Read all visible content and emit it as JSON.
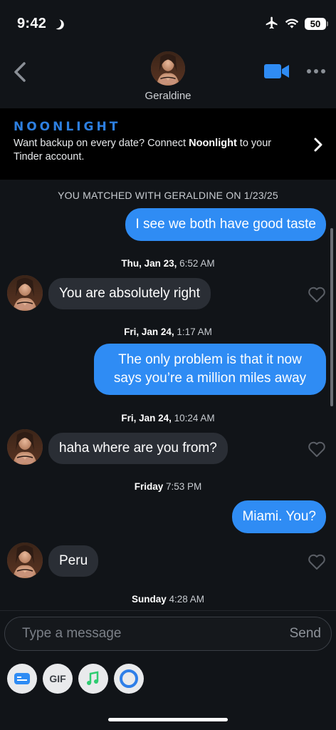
{
  "status_bar": {
    "time": "9:42",
    "battery": "50"
  },
  "header": {
    "contact_name": "Geraldine"
  },
  "banner": {
    "brand": "NOONLIGHT",
    "text_before": "Want backup on every date? Connect ",
    "text_bold": "Noonlight",
    "text_after": " to your Tinder account."
  },
  "chat": {
    "match_line": "YOU MATCHED WITH GERALDINE ON 1/23/25",
    "messages": [
      {
        "text": "I see we both have good taste"
      },
      {
        "ts_bold": "Thu, Jan 23,",
        "ts_rest": " 6:52 AM"
      },
      {
        "text": "You are absolutely right"
      },
      {
        "ts_bold": "Fri, Jan 24,",
        "ts_rest": " 1:17 AM"
      },
      {
        "text": "The only problem is that it now says you’re a million miles away"
      },
      {
        "ts_bold": "Fri, Jan 24,",
        "ts_rest": " 10:24 AM"
      },
      {
        "text": "haha where are you from?"
      },
      {
        "ts_bold": "Friday",
        "ts_rest": " 7:53 PM"
      },
      {
        "text": "Miami. You?"
      },
      {
        "text": "Peru"
      },
      {
        "ts_bold": "Sunday",
        "ts_rest": " 4:28 AM"
      }
    ]
  },
  "composer": {
    "placeholder": "Type a message",
    "send_label": "Send",
    "gif_label": "GIF"
  },
  "colors": {
    "outgoing_bubble": "#2f8cf4",
    "incoming_bubble": "#2a2e35",
    "brand_blue": "#2d7fe0"
  }
}
